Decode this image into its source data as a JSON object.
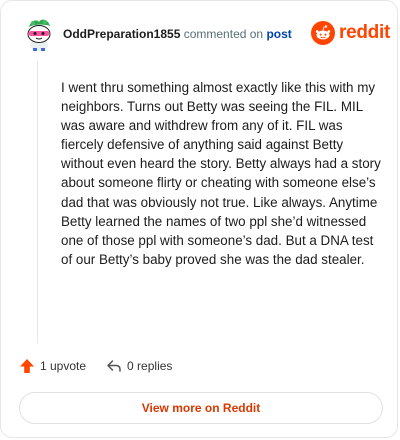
{
  "header": {
    "username": "OddPreparation1855",
    "commented_text": "commented on",
    "post_link": "post",
    "brand": "reddit"
  },
  "comment": {
    "body": "I went thru something almost exactly like this with my neighbors. Turns out Betty was seeing the FIL. MIL was aware and withdrew from any of it. FIL was fiercely defensive of anything said against Betty without even heard the story. Betty always had a story about someone flirty or cheating with someone else’s dad that was obviously not true. Like always. Anytime Betty learned the names of two ppl she’d witnessed one of those ppl with someone’s dad. But a DNA test of our Betty’s baby proved she was the dad stealer."
  },
  "actions": {
    "upvote_label": "1 upvote",
    "replies_label": "0 replies"
  },
  "footer": {
    "view_more_label": "View more on Reddit"
  },
  "colors": {
    "brand_orange": "#ff4500",
    "link_blue": "#0045ac",
    "cta_text": "#d93900"
  },
  "icons": {
    "avatar": "snoo-avatar",
    "logo": "reddit-snoo-icon",
    "upvote": "upvote-arrow-icon",
    "reply": "reply-arrow-icon"
  }
}
